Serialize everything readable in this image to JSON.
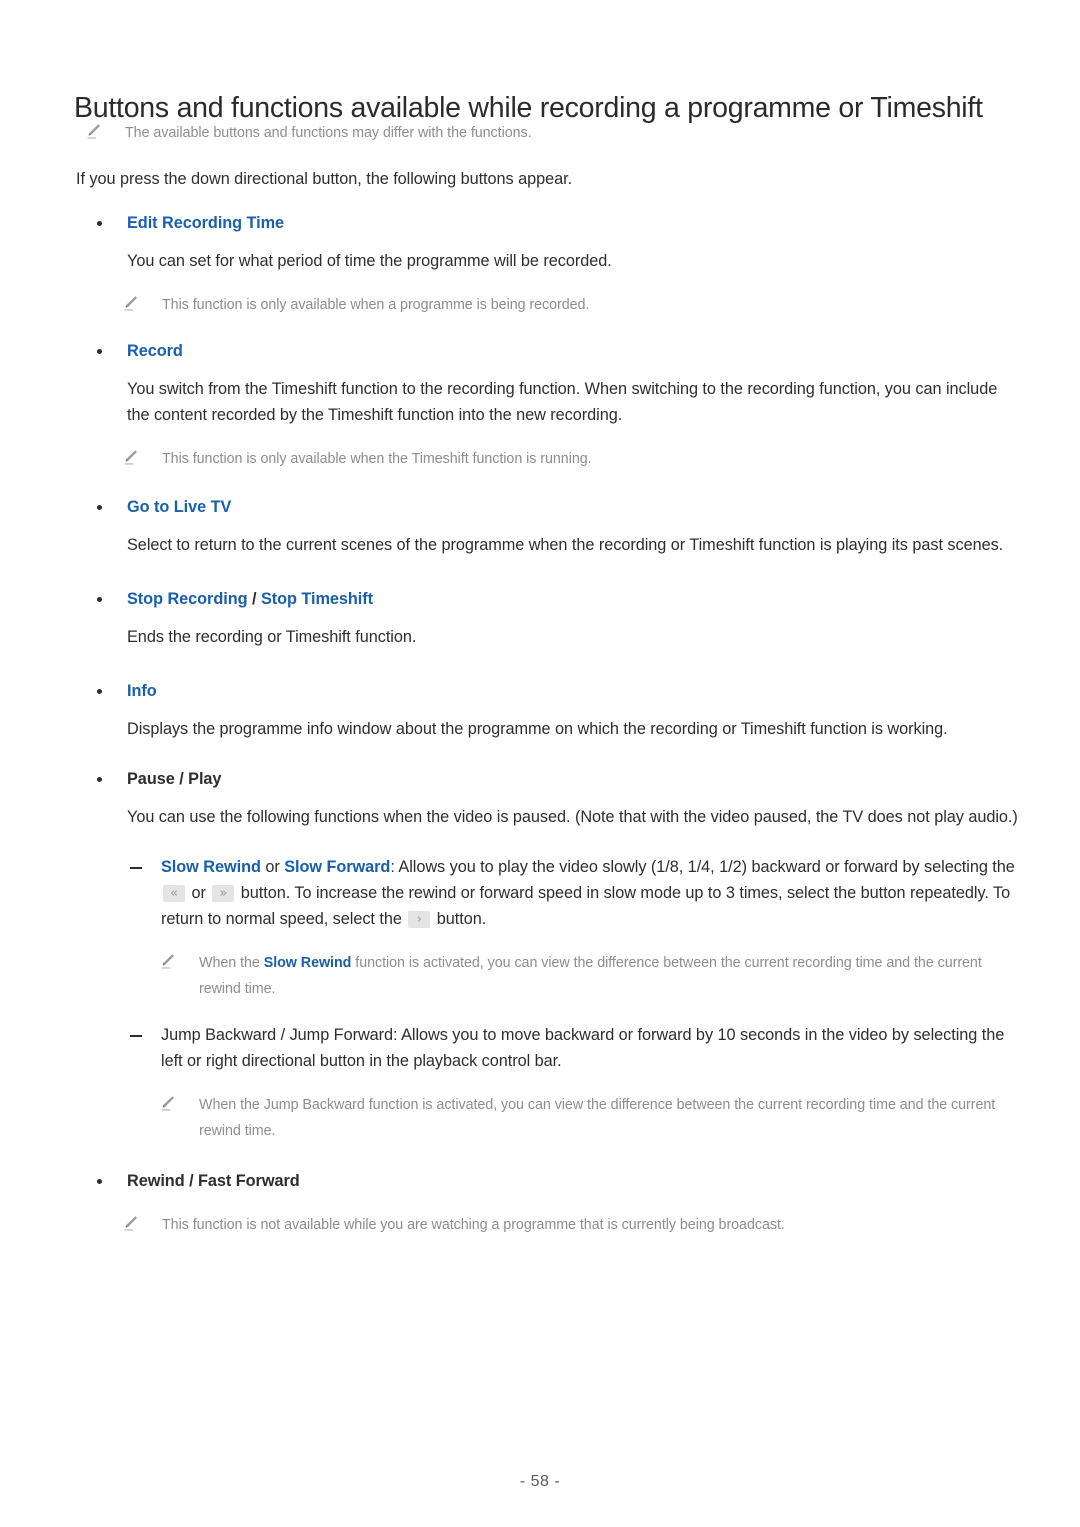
{
  "document": {
    "title": "Buttons and functions available while recording a programme or Timeshift",
    "page_number": "- 58 -"
  },
  "notes": {
    "top": "The available buttons and functions may differ with the functions.",
    "edit_recording_time": "This function is only available when a programme is being recorded.",
    "record": "This function is only available when the Timeshift function is running.",
    "slow_rewind_a": "When the ",
    "slow_rewind_kw": "Slow Rewind",
    "slow_rewind_b": " function is activated, you can view the difference between the current recording time and the current rewind time.",
    "jump_backward": "When the Jump Backward function is activated, you can view the difference between the current recording time and the current rewind time.",
    "rewind_fast_forward": "This function is not available while you are watching a programme that is currently being broadcast."
  },
  "intro": "If you press the down directional button, the following buttons appear.",
  "sections": {
    "edit_recording_time": {
      "label": "Edit Recording Time",
      "body": "You can set for what period of time the programme will be recorded."
    },
    "record": {
      "label": "Record",
      "body": "You switch from the Timeshift function to the recording function. When switching to the recording function, you can include the content recorded by the Timeshift function into the new recording."
    },
    "go_to_live_tv": {
      "label": "Go to Live TV",
      "body": "Select to return to the current scenes of the programme when the recording or Timeshift function is playing its past scenes."
    },
    "stop_recording": {
      "label_a": "Stop Recording",
      "separator": " / ",
      "label_b": "Stop Timeshift",
      "body": "Ends the recording or Timeshift function."
    },
    "info": {
      "label": "Info",
      "body": "Displays the programme info window about the programme on which the recording or Timeshift function is working."
    },
    "pause_play": {
      "label": "Pause / Play",
      "body": "You can use the following functions when the video is paused. (Note that with the video paused, the TV does not play audio.)"
    },
    "slow": {
      "kw_a": "Slow Rewind",
      "mid_a": " or ",
      "kw_b": "Slow Forward",
      "text_a": ": Allows you to play the video slowly (1/8, 1/4, 1/2) backward or forward by selecting the ",
      "key_rewind": "«",
      "text_b": " or ",
      "key_forward": "»",
      "text_c": " button. To increase the rewind or forward speed in slow mode up to 3 times, select the button repeatedly. To return to normal speed, select the ",
      "key_play": "›",
      "text_d": " button."
    },
    "jump": {
      "text": "Jump Backward / Jump Forward: Allows you to move backward or forward by 10 seconds in the video by selecting the left or right directional button in the playback control bar."
    },
    "rewind_fast_forward": {
      "label": "Rewind / Fast Forward"
    }
  },
  "colors": {
    "link_blue": "#1a5fab",
    "body_text": "#2e2e2e",
    "note_gray": "#8d8d8d",
    "key_bg": "#e4e4e4"
  },
  "icons": {
    "note": "pencil-icon",
    "bullet": "bullet-dot-icon",
    "dash": "dash-icon"
  }
}
